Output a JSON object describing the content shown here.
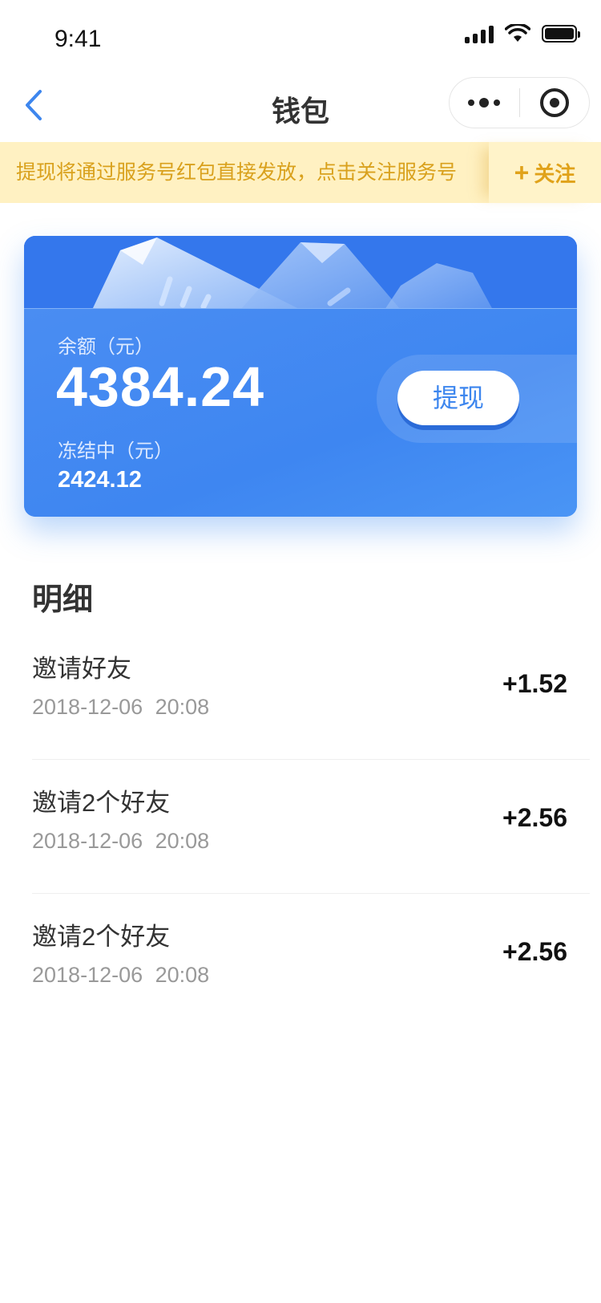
{
  "status_bar": {
    "time": "9:41"
  },
  "navbar": {
    "title": "钱包"
  },
  "notice": {
    "text": "提现将通过服务号红包直接发放，点击关注服务号",
    "follow_label": "关注"
  },
  "card": {
    "balance_label": "余额（元）",
    "balance": "4384.24",
    "frozen_label": "冻结中（元）",
    "frozen": "2424.12",
    "withdraw_label": "提现"
  },
  "details": {
    "title": "明细",
    "items": [
      {
        "name": "邀请好友",
        "date": "2018-12-06 20:08",
        "amount": "+1.52"
      },
      {
        "name": "邀请2个好友",
        "date": "2018-12-06 20:08",
        "amount": "+2.56"
      },
      {
        "name": "邀请2个好友",
        "date": "2018-12-06 20:08",
        "amount": "+2.56"
      }
    ]
  },
  "colors": {
    "accent": "#3d86ee",
    "notice_text": "#d9a11d",
    "notice_bg": "#fff1c2"
  },
  "icons": {
    "back": "chevron-left-icon",
    "more": "more-dots-icon",
    "close": "target-icon",
    "follow": "plus-icon"
  }
}
